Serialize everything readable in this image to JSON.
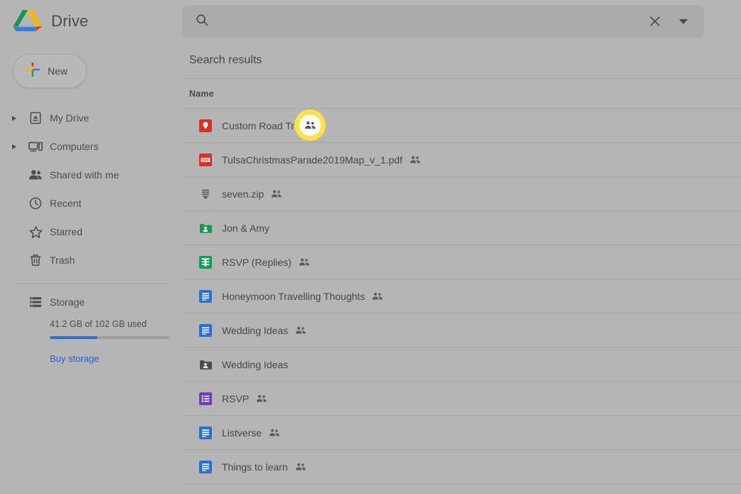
{
  "app": {
    "title": "Drive",
    "logo_icon": "google-drive-logo"
  },
  "search": {
    "value": "",
    "placeholder": "",
    "search_icon": "search-icon",
    "clear_icon": "close-icon",
    "options_icon": "chevron-down-icon"
  },
  "sidebar": {
    "new_button": {
      "label": "New",
      "icon": "plus-icon"
    },
    "items": [
      {
        "label": "My Drive",
        "icon": "drive-file-icon",
        "expandable": true
      },
      {
        "label": "Computers",
        "icon": "computer-icon",
        "expandable": true
      },
      {
        "label": "Shared with me",
        "icon": "people-icon",
        "expandable": false
      },
      {
        "label": "Recent",
        "icon": "clock-icon",
        "expandable": false
      },
      {
        "label": "Starred",
        "icon": "star-icon",
        "expandable": false
      },
      {
        "label": "Trash",
        "icon": "trash-icon",
        "expandable": false
      }
    ],
    "storage": {
      "label": "Storage",
      "icon": "storage-icon",
      "usage_text": "41.2 GB of 102 GB used",
      "used_percent": 40,
      "buy_label": "Buy storage",
      "bar_color": "#2f6fd0",
      "link_color": "#2a61c4"
    }
  },
  "main": {
    "results_title": "Search results",
    "column_header": "Name",
    "rows": [
      {
        "name": "Custom Road Trip",
        "icon": "map-pin-icon",
        "icon_color": "#d93025",
        "shared": true
      },
      {
        "name": "TulsaChristmasParade2019Map_v_1.pdf",
        "icon": "pdf-file-icon",
        "icon_color": "#d93025",
        "shared": true
      },
      {
        "name": "seven.zip",
        "icon": "archive-zip-icon",
        "icon_color": "#5f6368",
        "shared": true
      },
      {
        "name": "Jon & Amy",
        "icon": "shared-folder-icon",
        "icon_color": "#149b53",
        "shared": false
      },
      {
        "name": "RSVP (Replies)",
        "icon": "google-sheets-icon",
        "icon_color": "#149b53",
        "shared": true
      },
      {
        "name": "Honeymoon Travelling Thoughts",
        "icon": "google-docs-icon",
        "icon_color": "#2b6fd4",
        "shared": true
      },
      {
        "name": "Wedding Ideas",
        "icon": "google-docs-icon",
        "icon_color": "#2b6fd4",
        "shared": true
      },
      {
        "name": "Wedding Ideas",
        "icon": "shared-folder-icon",
        "icon_color": "#4a4d51",
        "shared": false
      },
      {
        "name": "RSVP",
        "icon": "google-forms-icon",
        "icon_color": "#6b3fb5",
        "shared": true
      },
      {
        "name": "Listverse",
        "icon": "google-docs-icon",
        "icon_color": "#2b6fd4",
        "shared": true
      },
      {
        "name": "Things to learn",
        "icon": "google-docs-icon",
        "icon_color": "#2b6fd4",
        "shared": true
      }
    ]
  },
  "cursor_highlight": {
    "icon": "people-shared-icon",
    "highlight_color": "#ffe14a"
  }
}
